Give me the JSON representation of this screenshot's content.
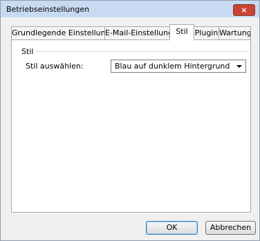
{
  "window": {
    "title": "Betriebseinstellungen",
    "close_glyph": "×"
  },
  "tabs": [
    {
      "label": "Grundlegende Einstellungen",
      "active": false
    },
    {
      "label": "E-Mail-Einstellungen",
      "active": false
    },
    {
      "label": "Stil",
      "active": true
    },
    {
      "label": "Plugin",
      "active": false
    },
    {
      "label": "Wartung",
      "active": false
    }
  ],
  "style_panel": {
    "group_label": "Stil",
    "select_label": "Stil auswählen:",
    "select_value": "Blau auf dunklem Hintergrund"
  },
  "buttons": {
    "ok": "OK",
    "cancel": "Abbrechen"
  },
  "colors": {
    "titlebar": "#c8daf2",
    "close_button": "#c94433",
    "dialog_bg": "#f0f0f0",
    "panel_bg": "#ffffff"
  }
}
